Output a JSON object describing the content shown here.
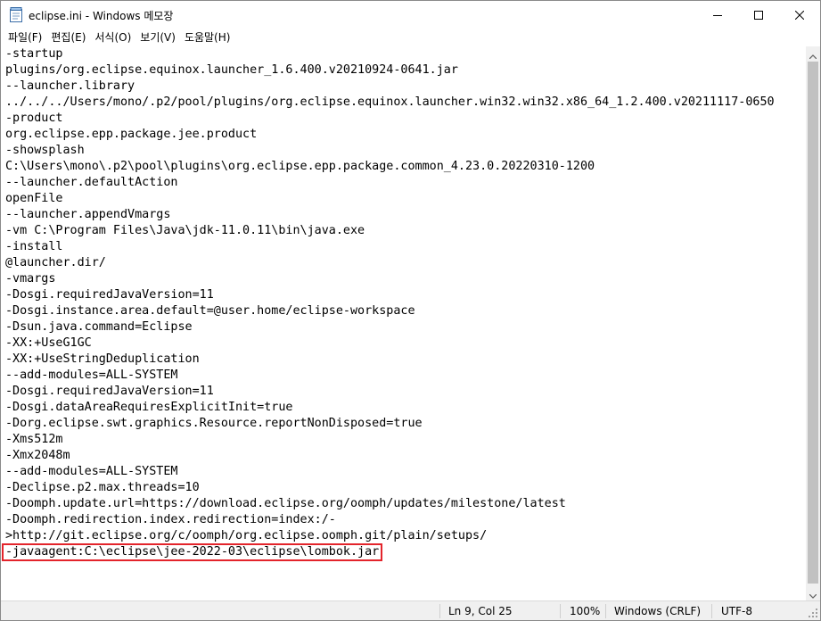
{
  "window": {
    "title": "eclipse.ini - Windows 메모장",
    "app_icon": "notepad-icon",
    "controls": {
      "minimize": "minimize-icon",
      "maximize": "maximize-icon",
      "close": "close-icon"
    }
  },
  "menu": {
    "items": [
      "파일(F)",
      "편집(E)",
      "서식(O)",
      "보기(V)",
      "도움말(H)"
    ]
  },
  "editor": {
    "lines": [
      "-startup",
      "plugins/org.eclipse.equinox.launcher_1.6.400.v20210924-0641.jar",
      "--launcher.library",
      "../../../Users/mono/.p2/pool/plugins/org.eclipse.equinox.launcher.win32.win32.x86_64_1.2.400.v20211117-0650",
      "-product",
      "org.eclipse.epp.package.jee.product",
      "-showsplash",
      "C:\\Users\\mono\\.p2\\pool\\plugins\\org.eclipse.epp.package.common_4.23.0.20220310-1200",
      "--launcher.defaultAction",
      "openFile",
      "--launcher.appendVmargs",
      "-vm C:\\Program Files\\Java\\jdk-11.0.11\\bin\\java.exe",
      "-install",
      "@launcher.dir/",
      "-vmargs",
      "-Dosgi.requiredJavaVersion=11",
      "-Dosgi.instance.area.default=@user.home/eclipse-workspace",
      "-Dsun.java.command=Eclipse",
      "-XX:+UseG1GC",
      "-XX:+UseStringDeduplication",
      "--add-modules=ALL-SYSTEM",
      "-Dosgi.requiredJavaVersion=11",
      "-Dosgi.dataAreaRequiresExplicitInit=true",
      "-Dorg.eclipse.swt.graphics.Resource.reportNonDisposed=true",
      "-Xms512m",
      "-Xmx2048m",
      "--add-modules=ALL-SYSTEM",
      "-Declipse.p2.max.threads=10",
      "-Doomph.update.url=https://download.eclipse.org/oomph/updates/milestone/latest",
      "-Doomph.redirection.index.redirection=index:/-",
      ">http://git.eclipse.org/c/oomph/org.eclipse.oomph.git/plain/setups/",
      "-javaagent:C:\\eclipse\\jee-2022-03\\eclipse\\lombok.jar"
    ],
    "highlight_color": "#e3242b"
  },
  "status": {
    "position": "Ln 9, Col 25",
    "zoom": "100%",
    "line_ending": "Windows (CRLF)",
    "encoding": "UTF-8"
  }
}
